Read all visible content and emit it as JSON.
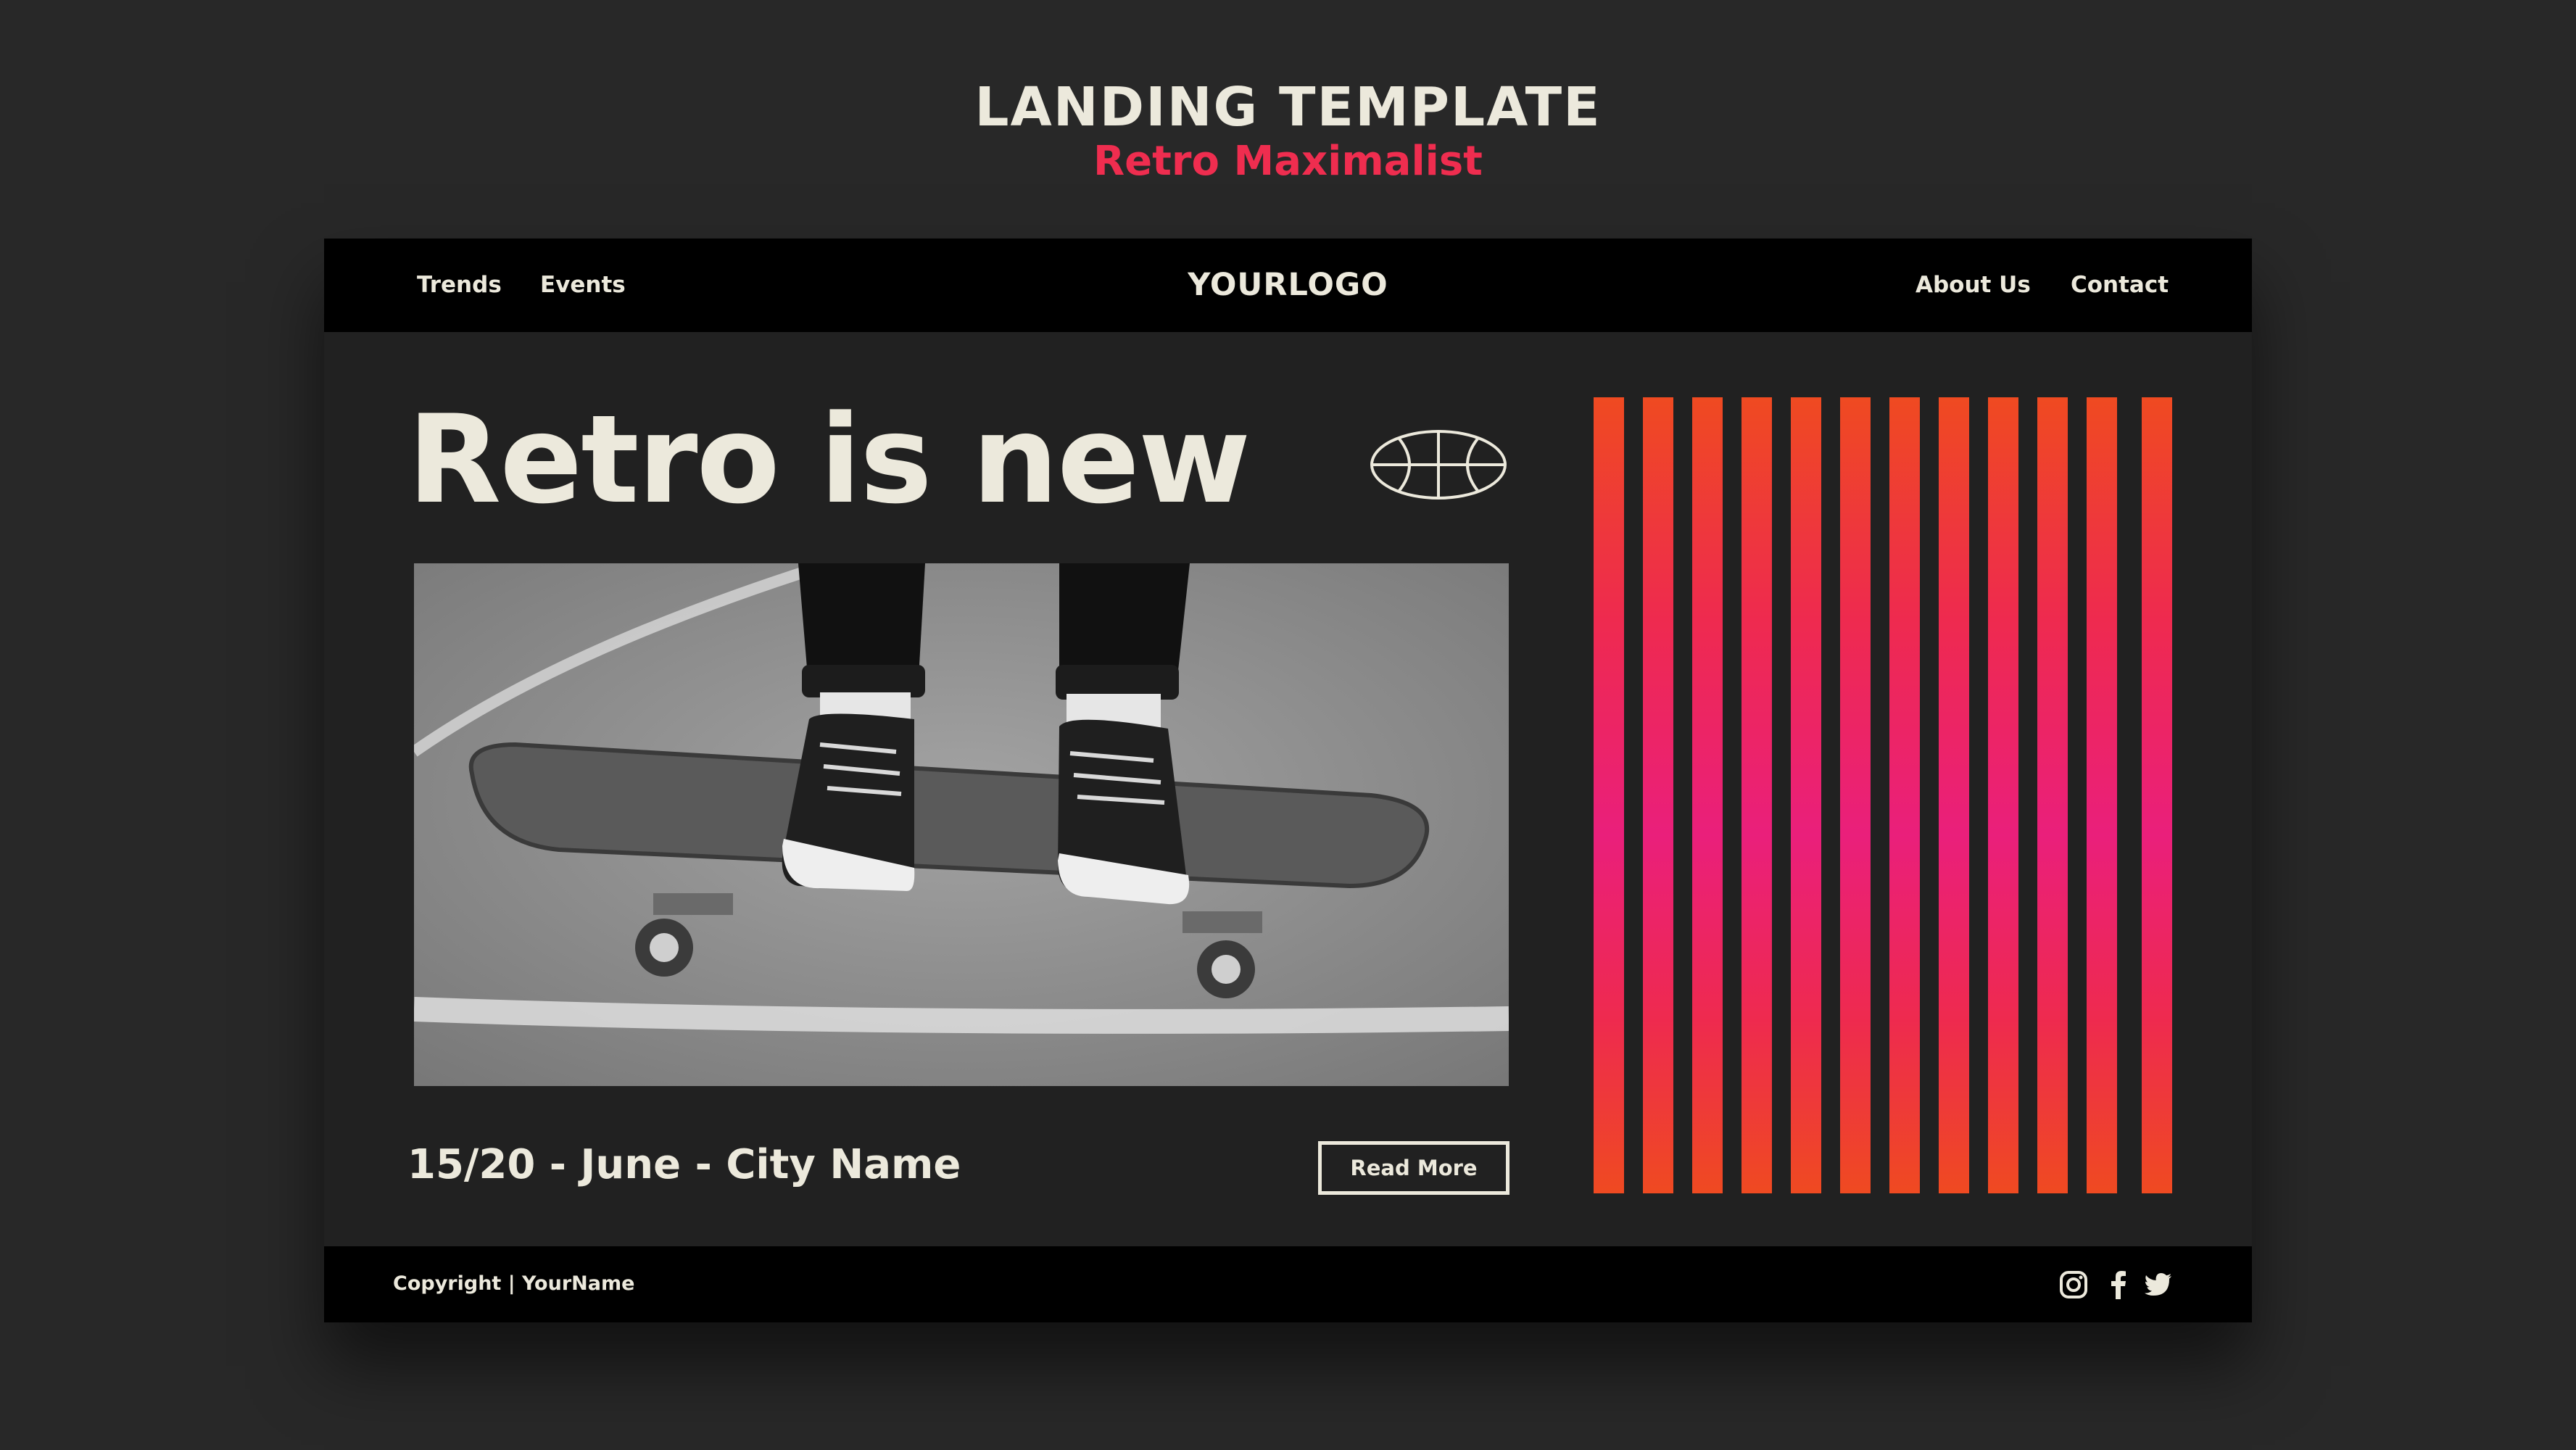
{
  "showcase": {
    "title": "LANDING TEMPLATE",
    "subtitle": "Retro Maximalist",
    "accent_color": "#ef2d4f"
  },
  "nav": {
    "left_links": [
      "Trends",
      "Events"
    ],
    "logo": "YOURLOGO",
    "right_links": [
      "About Us",
      "Contact"
    ]
  },
  "hero": {
    "headline": "Retro is new",
    "decoration_icon": "basketball-icon",
    "photo": "black-and-white photo of sneakers standing on a skateboard on asphalt",
    "event_info": "15/20 - June - City Name",
    "cta_label": "Read More"
  },
  "stripes": {
    "count": 12,
    "gradient_colors": [
      "#ef4a21",
      "#ee2a4f",
      "#ea1f7b"
    ]
  },
  "footer": {
    "copyright": "Copyright | YourName",
    "social_icons": [
      "instagram-icon",
      "facebook-icon",
      "twitter-icon"
    ]
  },
  "colors": {
    "background": "#282828",
    "page": "#212121",
    "bars": "#000000",
    "text": "#ece9dc"
  }
}
